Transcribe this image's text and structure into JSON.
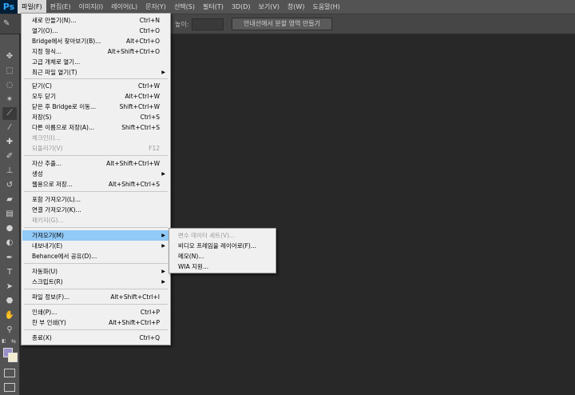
{
  "app": {
    "logo": "Ps"
  },
  "menubar": [
    {
      "label": "파일(F)",
      "active": true
    },
    {
      "label": "편집(E)"
    },
    {
      "label": "이미지(I)"
    },
    {
      "label": "레이어(L)"
    },
    {
      "label": "문자(Y)"
    },
    {
      "label": "선택(S)"
    },
    {
      "label": "필터(T)"
    },
    {
      "label": "3D(D)"
    },
    {
      "label": "보기(V)"
    },
    {
      "label": "창(W)"
    },
    {
      "label": "도움말(H)"
    }
  ],
  "optbar": {
    "height_label": "높이:",
    "button_label": "안내선에서 분할 영역 만들기"
  },
  "file_menu": {
    "items": [
      {
        "label": "새로 만들기(N)...",
        "shortcut": "Ctrl+N"
      },
      {
        "label": "열기(O)...",
        "shortcut": "Ctrl+O"
      },
      {
        "label": "Bridge에서 찾아보기(B)...",
        "shortcut": "Alt+Ctrl+O"
      },
      {
        "label": "지정 형식...",
        "shortcut": "Alt+Shift+Ctrl+O"
      },
      {
        "label": "고급 개체로 열기...",
        "shortcut": ""
      },
      {
        "label": "최근 파일 열기(T)",
        "shortcut": ""
      },
      {
        "label": "닫기(C)",
        "shortcut": "Ctrl+W"
      },
      {
        "label": "모두 닫기",
        "shortcut": "Alt+Ctrl+W"
      },
      {
        "label": "닫은 후 Bridge로 이동...",
        "shortcut": "Shift+Ctrl+W"
      },
      {
        "label": "저장(S)",
        "shortcut": "Ctrl+S"
      },
      {
        "label": "다른 이름으로 저장(A)...",
        "shortcut": "Shift+Ctrl+S"
      },
      {
        "label": "체크인(I)...",
        "shortcut": ""
      },
      {
        "label": "되돌리기(V)",
        "shortcut": "F12"
      },
      {
        "label": "자산 추출...",
        "shortcut": "Alt+Shift+Ctrl+W"
      },
      {
        "label": "생성",
        "shortcut": ""
      },
      {
        "label": "웹용으로 저장...",
        "shortcut": "Alt+Shift+Ctrl+S"
      },
      {
        "label": "포함 가져오기(L)...",
        "shortcut": ""
      },
      {
        "label": "연결 가져오기(K)...",
        "shortcut": ""
      },
      {
        "label": "패키지(G)...",
        "shortcut": ""
      },
      {
        "label": "가져오기(M)",
        "shortcut": ""
      },
      {
        "label": "내보내기(E)",
        "shortcut": ""
      },
      {
        "label": "Behance에서 공유(D)...",
        "shortcut": ""
      },
      {
        "label": "자동화(U)",
        "shortcut": ""
      },
      {
        "label": "스크립트(R)",
        "shortcut": ""
      },
      {
        "label": "파일 정보(F)...",
        "shortcut": "Alt+Shift+Ctrl+I"
      },
      {
        "label": "인쇄(P)...",
        "shortcut": "Ctrl+P"
      },
      {
        "label": "한 부 인쇄(Y)",
        "shortcut": "Alt+Shift+Ctrl+P"
      },
      {
        "label": "종료(X)",
        "shortcut": "Ctrl+Q"
      }
    ]
  },
  "import_submenu": {
    "items": [
      {
        "label": "변수 데이터 세트(V)..."
      },
      {
        "label": "비디오 프레임을 레이어로(F)..."
      },
      {
        "label": "메모(N)..."
      },
      {
        "label": "WIA 지원..."
      }
    ]
  },
  "colors": {
    "foreground": "#9b8ec9",
    "background": "#f3ecd0",
    "menu_highlight": "#91c9f7"
  }
}
